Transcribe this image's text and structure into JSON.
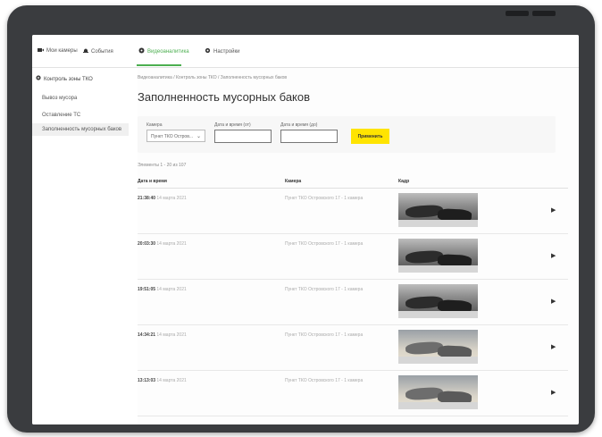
{
  "nav": {
    "items": [
      {
        "label": "Мои камеры",
        "icon": "camera-icon"
      },
      {
        "label": "События",
        "icon": "bell-icon"
      },
      {
        "label": "Видеоаналитика",
        "icon": "analytics-icon"
      },
      {
        "label": "Настройки",
        "icon": "gear-icon"
      }
    ]
  },
  "sidebar": {
    "section": "Контроль зоны ТКО",
    "items": [
      {
        "label": "Вывоз мусора"
      },
      {
        "label": "Оставление ТС"
      },
      {
        "label": "Заполненность мусорных баков"
      }
    ]
  },
  "main": {
    "breadcrumb": "Видеоаналитика / Контроль зоны ТКО / Заполненность мусорных баков",
    "title": "Заполненность мусорных баков",
    "filters": {
      "camera_label": "Камера",
      "camera_value": "Пункт ТКО Остров...",
      "from_label": "Дата и время (от)",
      "to_label": "Дата и время (до)",
      "from_value": "",
      "to_value": "",
      "apply_label": "Применить"
    },
    "count": "Элементы 1 - 20 из 107",
    "columns": [
      "Дата и время",
      "Камера",
      "Кадр"
    ],
    "rows": [
      {
        "time": "21:38:40",
        "date": "14 марта 2021",
        "camera": "Пункт ТКО Островского 17 - 1 камера"
      },
      {
        "time": "20:03:30",
        "date": "14 марта 2021",
        "camera": "Пункт ТКО Островского 17 - 1 камера"
      },
      {
        "time": "19:51:05",
        "date": "14 марта 2021",
        "camera": "Пункт ТКО Островского 17 - 1 камера"
      },
      {
        "time": "14:34:21",
        "date": "14 марта 2021",
        "camera": "Пункт ТКО Островского 17 - 1 камера"
      },
      {
        "time": "13:13:03",
        "date": "14 марта 2021",
        "camera": "Пункт ТКО Островского 17 - 1 камера"
      }
    ]
  },
  "colors": {
    "accent_green": "#4caf50",
    "apply_yellow": "#ffe400",
    "device_frame": "#3a3c3f"
  }
}
